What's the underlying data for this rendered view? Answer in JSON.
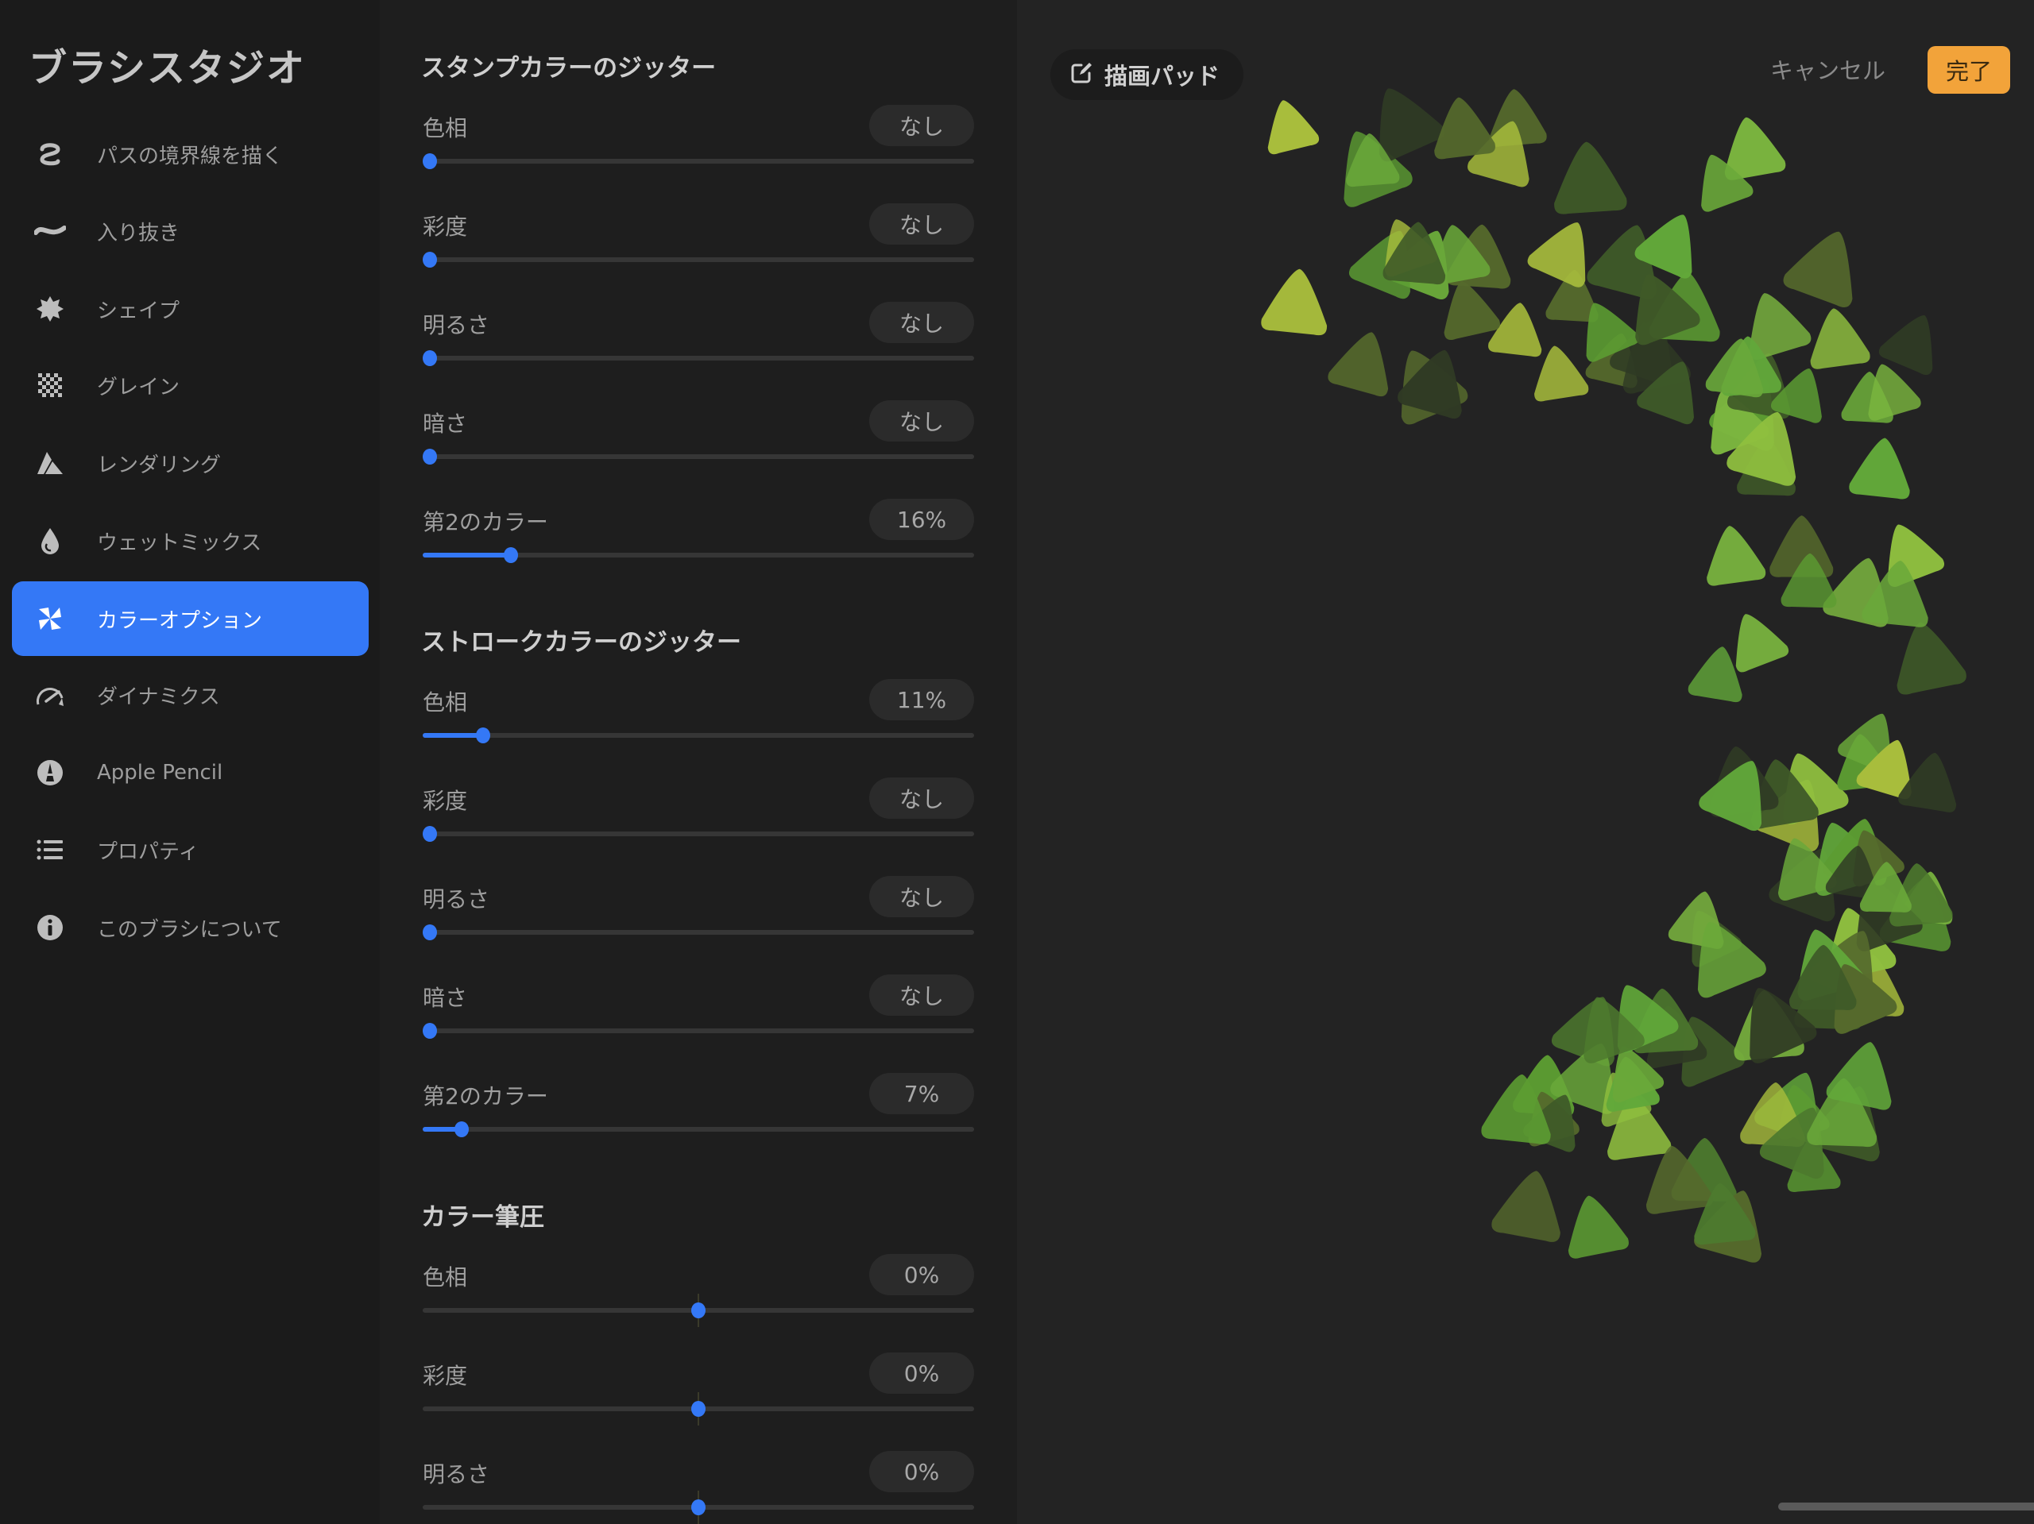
{
  "app": {
    "title": "ブラシスタジオ"
  },
  "sidebar": {
    "items": [
      {
        "label": "パスの境界線を描く",
        "icon": "stroke-path-icon",
        "active": false
      },
      {
        "label": "入り抜き",
        "icon": "taper-icon",
        "active": false
      },
      {
        "label": "シェイプ",
        "icon": "shape-icon",
        "active": false
      },
      {
        "label": "グレイン",
        "icon": "grain-icon",
        "active": false
      },
      {
        "label": "レンダリング",
        "icon": "rendering-icon",
        "active": false
      },
      {
        "label": "ウェットミックス",
        "icon": "wet-mix-icon",
        "active": false
      },
      {
        "label": "カラーオプション",
        "icon": "color-dynamics-icon",
        "active": true
      },
      {
        "label": "ダイナミクス",
        "icon": "dynamics-icon",
        "active": false
      },
      {
        "label": "Apple Pencil",
        "icon": "apple-pencil-icon",
        "active": false
      },
      {
        "label": "プロパティ",
        "icon": "properties-icon",
        "active": false
      },
      {
        "label": "このブラシについて",
        "icon": "info-icon",
        "active": false
      }
    ]
  },
  "sections": [
    {
      "title": "スタンプカラーのジッター",
      "rows": [
        {
          "label": "色相",
          "value": "なし",
          "fraction": 0.0,
          "centered": false
        },
        {
          "label": "彩度",
          "value": "なし",
          "fraction": 0.0,
          "centered": false
        },
        {
          "label": "明るさ",
          "value": "なし",
          "fraction": 0.0,
          "centered": false
        },
        {
          "label": "暗さ",
          "value": "なし",
          "fraction": 0.0,
          "centered": false
        },
        {
          "label": "第2のカラー",
          "value": "16%",
          "fraction": 0.16,
          "centered": false
        }
      ]
    },
    {
      "title": "ストロークカラーのジッター",
      "rows": [
        {
          "label": "色相",
          "value": "11%",
          "fraction": 0.11,
          "centered": false
        },
        {
          "label": "彩度",
          "value": "なし",
          "fraction": 0.0,
          "centered": false
        },
        {
          "label": "明るさ",
          "value": "なし",
          "fraction": 0.0,
          "centered": false
        },
        {
          "label": "暗さ",
          "value": "なし",
          "fraction": 0.0,
          "centered": false
        },
        {
          "label": "第2のカラー",
          "value": "7%",
          "fraction": 0.07,
          "centered": false
        }
      ]
    },
    {
      "title": "カラー筆圧",
      "rows": [
        {
          "label": "色相",
          "value": "0%",
          "fraction": 0.5,
          "centered": true
        },
        {
          "label": "彩度",
          "value": "0%",
          "fraction": 0.5,
          "centered": true
        },
        {
          "label": "明るさ",
          "value": "0%",
          "fraction": 0.5,
          "centered": true
        }
      ]
    }
  ],
  "preview": {
    "drawing_pad_label": "描画パッド",
    "cancel_label": "キャンセル",
    "done_label": "完了"
  },
  "colors": {
    "accent": "#3478f6",
    "done": "#f2a33a",
    "stamp_palette": [
      "#6aa83a",
      "#5c9c32",
      "#7bb63f",
      "#8fbf3f",
      "#a8bd3c",
      "#4d7a2e",
      "#3f5a28",
      "#55692c",
      "#62a83a",
      "#2f3a24"
    ]
  }
}
